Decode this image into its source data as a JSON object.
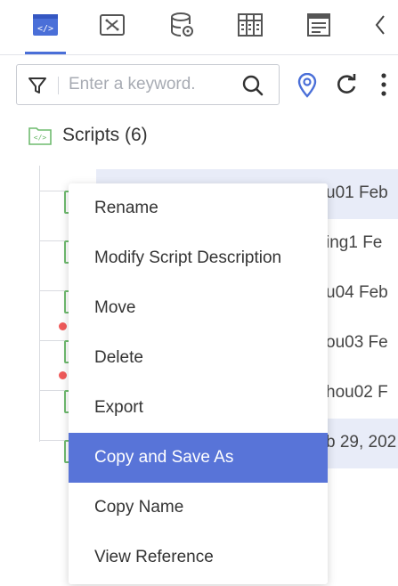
{
  "toolbar": {
    "tabs": [
      {
        "name": "code-tab",
        "icon": "code-icon",
        "active": true
      },
      {
        "name": "function-tab",
        "icon": "function-icon",
        "active": false
      },
      {
        "name": "database-tab",
        "icon": "database-icon",
        "active": false
      },
      {
        "name": "grid-tab",
        "icon": "grid-icon",
        "active": false
      },
      {
        "name": "document-tab",
        "icon": "document-icon",
        "active": false
      }
    ],
    "collapse_icon": "chevron-left-icon"
  },
  "search": {
    "placeholder": "Enter a keyword.",
    "value": ""
  },
  "tree": {
    "root_label": "Scripts (6)",
    "rows": [
      {
        "text": "u01  Feb",
        "selected": true
      },
      {
        "text": "ing1  Fe",
        "selected": false
      },
      {
        "text": "u04  Feb",
        "selected": false
      },
      {
        "text": "ou03  Fe",
        "selected": false
      },
      {
        "text": "hou02  F",
        "selected": false
      },
      {
        "text": "b 29, 202",
        "selected": true
      }
    ]
  },
  "context_menu": {
    "items": [
      "Rename",
      "Modify Script Description",
      "Move",
      "Delete",
      "Export",
      "Copy and Save As",
      "Copy Name",
      "View Reference"
    ],
    "active_index": 5
  },
  "colors": {
    "accent": "#4a6fd8",
    "menu_active": "#5874d8",
    "selected_row": "#e8ecf8",
    "script_green": "#6fbb6f",
    "error_dot": "#f05a5a"
  }
}
